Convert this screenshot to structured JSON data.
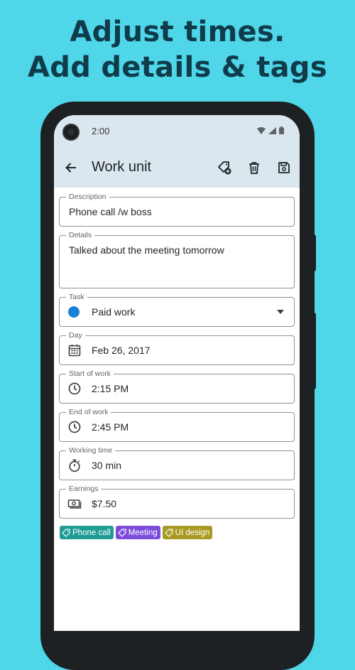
{
  "headline": {
    "line1": "Adjust times.",
    "line2": "Add details & tags"
  },
  "status_bar": {
    "time": "2:00"
  },
  "app_bar": {
    "title": "Work unit"
  },
  "form": {
    "description": {
      "label": "Description",
      "value": "Phone call /w boss"
    },
    "details": {
      "label": "Details",
      "value": "Talked about the meeting tomorrow"
    },
    "task": {
      "label": "Task",
      "value": "Paid work",
      "color": "#1a7fd6"
    },
    "day": {
      "label": "Day",
      "value": "Feb 26, 2017"
    },
    "start": {
      "label": "Start of work",
      "value": "2:15 PM"
    },
    "end": {
      "label": "End of work",
      "value": "2:45 PM"
    },
    "working_time": {
      "label": "Working time",
      "value": "30 min"
    },
    "earnings": {
      "label": "Earnings",
      "value": "$7.50"
    }
  },
  "tags": [
    {
      "label": "Phone call",
      "color": "#1f9c93"
    },
    {
      "label": "Meeting",
      "color": "#7c4ddb"
    },
    {
      "label": "UI design",
      "color": "#a89a22"
    }
  ]
}
